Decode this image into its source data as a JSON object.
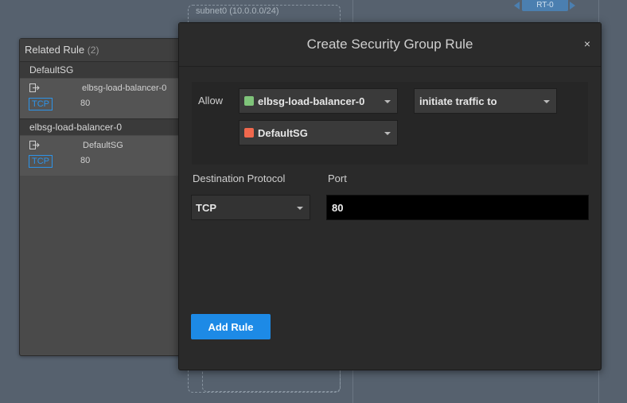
{
  "canvas": {
    "subnet_label": "subnet0 (10.0.0.0/24)",
    "route_table_label": "RT-0"
  },
  "related_rule": {
    "title": "Related Rule",
    "count": "(2)",
    "groups": [
      {
        "name": "DefaultSG",
        "rule": {
          "direction_icon": "outbound-arrow-icon",
          "target": "elbsg-load-balancer-0",
          "protocol": "TCP",
          "port": "80"
        }
      },
      {
        "name": "elbsg-load-balancer-0",
        "rule": {
          "direction_icon": "outbound-arrow-icon",
          "target": "DefaultSG",
          "protocol": "TCP",
          "port": "80"
        }
      }
    ]
  },
  "modal": {
    "title": "Create Security Group Rule",
    "close_label": "×",
    "allow_label": "Allow",
    "source_sg": {
      "label": "elbsg-load-balancer-0",
      "color": "#7fc47a"
    },
    "direction": {
      "label": "initiate traffic to"
    },
    "target_sg": {
      "label": "DefaultSG",
      "color": "#f0684d"
    },
    "protocol_label": "Destination Protocol",
    "protocol_value": "TCP",
    "port_label": "Port",
    "port_value": "80",
    "submit_label": "Add Rule"
  }
}
